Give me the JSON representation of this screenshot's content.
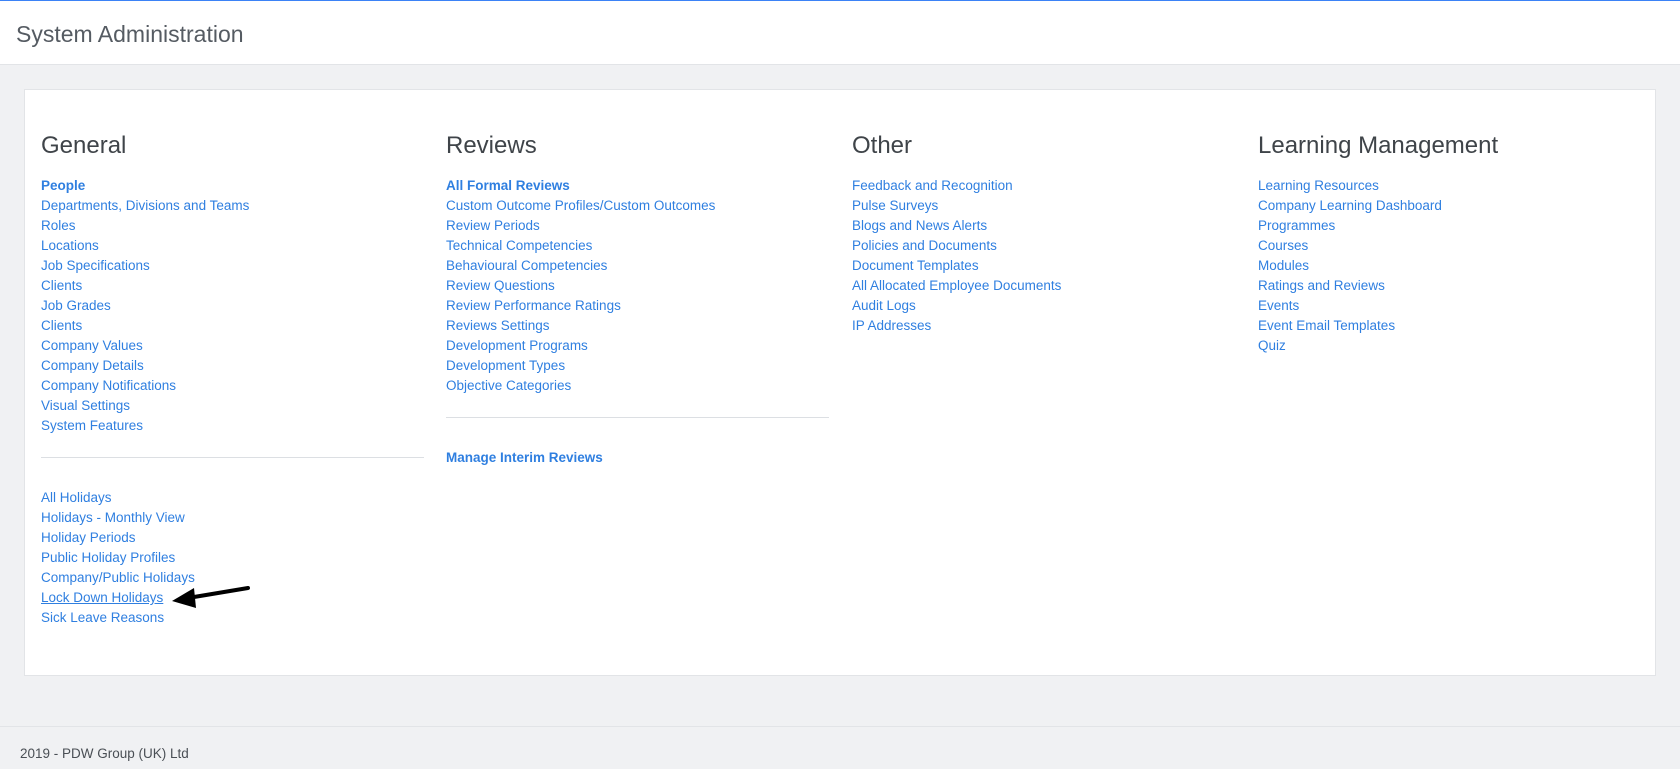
{
  "header": {
    "title": "System Administration"
  },
  "columns": {
    "general": {
      "heading": "General",
      "links": [
        "People",
        "Departments, Divisions and Teams",
        "Roles",
        "Locations",
        "Job Specifications",
        "Clients",
        "Job Grades",
        "Clients",
        "Company Values",
        "Company Details",
        "Company Notifications",
        "Visual Settings",
        "System Features"
      ],
      "holiday_links": [
        "All Holidays",
        "Holidays - Monthly View",
        "Holiday Periods",
        "Public Holiday Profiles",
        "Company/Public Holidays",
        "Lock Down Holidays",
        "Sick Leave Reasons"
      ]
    },
    "reviews": {
      "heading": "Reviews",
      "links": [
        "All Formal Reviews",
        "Custom Outcome Profiles/Custom Outcomes",
        "Review Periods",
        "Technical Competencies",
        "Behavioural Competencies",
        "Review Questions",
        "Review Performance Ratings",
        "Reviews Settings",
        "Development Programs",
        "Development Types",
        "Objective Categories"
      ],
      "interim_link": "Manage Interim Reviews"
    },
    "other": {
      "heading": "Other",
      "links": [
        "Feedback and Recognition",
        "Pulse Surveys",
        "Blogs and News Alerts",
        "Policies and Documents",
        "Document Templates",
        "All Allocated Employee Documents",
        "Audit Logs",
        "IP Addresses"
      ]
    },
    "learning": {
      "heading": "Learning Management",
      "links": [
        "Learning Resources",
        "Company Learning Dashboard",
        "Programmes",
        "Courses",
        "Modules",
        "Ratings and Reviews",
        "Events",
        "Event Email Templates",
        "Quiz"
      ]
    }
  },
  "footer": {
    "text": "2019 - PDW Group (UK) Ltd"
  },
  "colors": {
    "link": "#2f7fe0",
    "heading": "#3f4449",
    "background": "#f0f1f3",
    "accent": "#3b82f6"
  }
}
